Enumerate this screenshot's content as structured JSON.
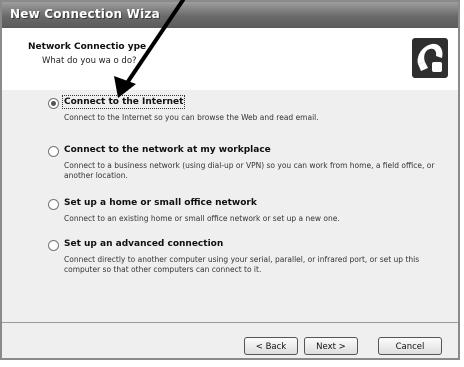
{
  "window": {
    "title": "New Connection Wiza"
  },
  "header": {
    "title": "Network Connectio  ype",
    "subtitle": "What do you wa    o do?",
    "icon": "wizard-phone-icon"
  },
  "options": [
    {
      "label": "Connect to the Internet",
      "description": "Connect to the Internet so you can browse the Web and read email.",
      "selected": true
    },
    {
      "label": "Connect to the network at my workplace",
      "description": "Connect to a business network (using dial-up or VPN) so you can work from home, a field office, or another location.",
      "selected": false
    },
    {
      "label": "Set up a home or small office network",
      "description": "Connect to an existing home or small office network or set up a new one.",
      "selected": false
    },
    {
      "label": "Set up an advanced connection",
      "description": "Connect directly to another computer using your serial, parallel, or infrared port, or set up this computer so that other computers can connect to it.",
      "selected": false
    }
  ],
  "footer": {
    "back_label": "< Back",
    "next_label": "Next >",
    "cancel_label": "Cancel"
  }
}
